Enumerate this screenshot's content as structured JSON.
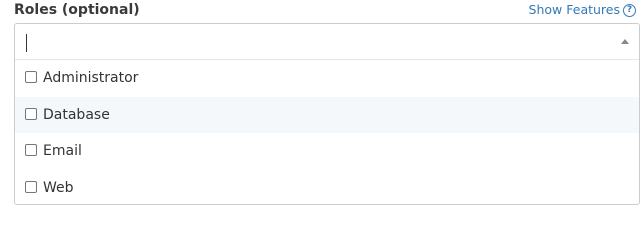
{
  "field": {
    "label": "Roles (optional)",
    "help_link": "Show Features",
    "help_icon": "question-circle-icon",
    "search_value": ""
  },
  "options": [
    {
      "label": "Administrator",
      "checked": false
    },
    {
      "label": "Database",
      "checked": false,
      "highlighted": true
    },
    {
      "label": "Email",
      "checked": false
    },
    {
      "label": "Web",
      "checked": false
    }
  ]
}
